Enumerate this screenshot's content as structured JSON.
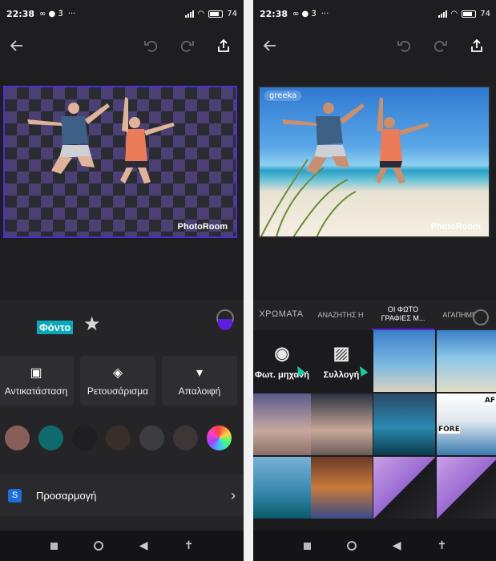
{
  "left": {
    "status": {
      "time": "22:38",
      "extra": "∞ ● 3̈",
      "battery": "74"
    },
    "preview": {
      "watermark": "PhotoRoom"
    },
    "panel": {
      "background_label": "Φόντο"
    },
    "tools": [
      {
        "label": "Αντικατάσταση",
        "icon": "replace-image-icon"
      },
      {
        "label": "Ρετουσάρισμα",
        "icon": "eraser-icon"
      },
      {
        "label": "Απαλοιφή",
        "icon": "trash-icon"
      }
    ],
    "swatches": [
      "#8a5e58",
      "#0f6a6e",
      "#1f1f21",
      "#3a2e28",
      "#3d3d40",
      "#3d3536"
    ],
    "adjust": {
      "label": "Προσαρμογή"
    }
  },
  "right": {
    "status": {
      "time": "22:38",
      "extra": "∞ ● 3̈",
      "battery": "74"
    },
    "preview": {
      "watermark": "PhotoRoom",
      "tag": "greeka"
    },
    "tabs": [
      {
        "label": "ΧΡΩΜΑΤΑ"
      },
      {
        "label": "ΑΝΑΖΗΤΗΣ Η"
      },
      {
        "label": "ΟΙ ΦΩΤΟ ΓΡΑΦΙΕΣ Μ..."
      },
      {
        "label": "ΑΓΑΠΗΜΕΝ Α"
      }
    ],
    "sources": [
      {
        "label": "Φωτ. μηχανή",
        "icon": "camera-icon"
      },
      {
        "label": "Συλλογή",
        "icon": "gallery-icon"
      }
    ],
    "thumbs": {
      "t1_text": "AF",
      "t2_text": "FORE"
    }
  },
  "colors": {
    "accent": "#5c1fe0",
    "teal": "#0aa8b8",
    "frame": "#4a2fd8"
  }
}
